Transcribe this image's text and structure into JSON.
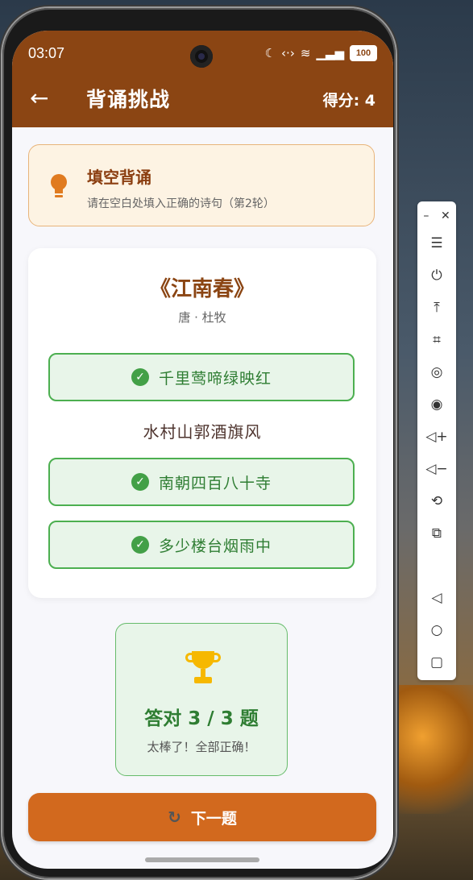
{
  "status_bar": {
    "time": "03:07",
    "icons": [
      "moon-icon",
      "data-sync-icon",
      "wifi-icon",
      "signal-icon"
    ],
    "battery": "100"
  },
  "app_bar": {
    "title": "背诵挑战",
    "score": "得分: 4"
  },
  "tip_card": {
    "title": "填空背诵",
    "subtitle": "请在空白处填入正确的诗句（第2轮）"
  },
  "poem": {
    "title": "《江南春》",
    "author": "唐 · 杜牧",
    "lines": [
      {
        "text": "千里莺啼绿映红",
        "state": "correct"
      },
      {
        "text": "水村山郭酒旗风",
        "state": "given"
      },
      {
        "text": "南朝四百八十寺",
        "state": "correct"
      },
      {
        "text": "多少楼台烟雨中",
        "state": "correct"
      }
    ]
  },
  "result": {
    "title": "答对 3 / 3 题",
    "message": "太棒了！全部正确！"
  },
  "next_button": {
    "label": "下一题",
    "icon": "refresh-icon"
  },
  "side_toolbar": {
    "buttons": [
      "menu-icon",
      "power-icon",
      "pin-top-icon",
      "crop-icon",
      "rotate-icon",
      "record-icon",
      "volume-up-icon",
      "volume-down-icon",
      "rotate-screen-icon",
      "screenshot-icon",
      "back-icon",
      "home-icon",
      "recents-icon"
    ]
  },
  "colors": {
    "header": "#8b4513",
    "accent": "#d2691e",
    "success": "#4caf50",
    "success_bg": "#e8f5e9",
    "tip_bg": "#fdf3e3",
    "trophy": "#f6b800"
  }
}
